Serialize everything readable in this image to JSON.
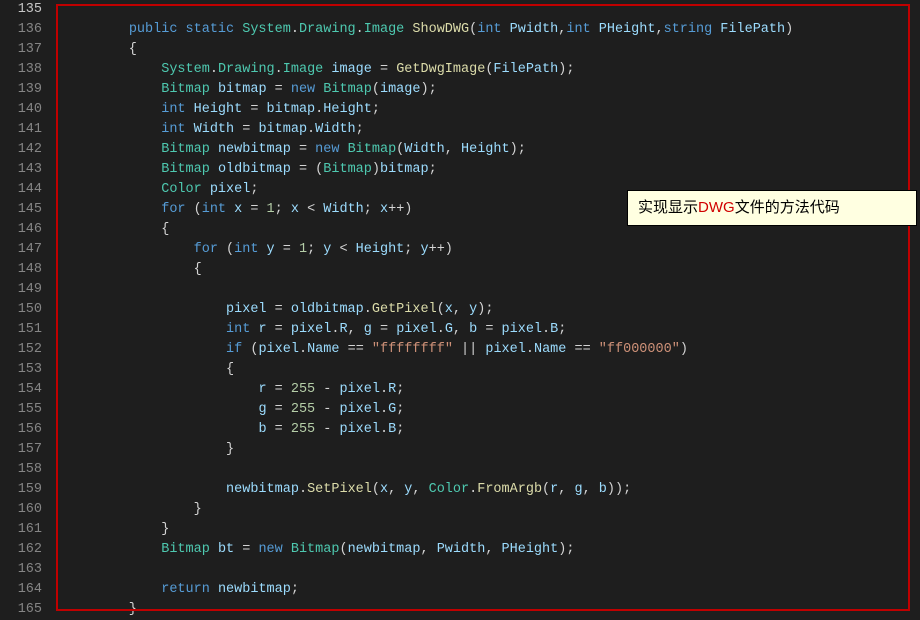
{
  "line_start": 135,
  "line_end": 165,
  "code_lines": [
    [],
    [
      [
        "        ",
        "plain"
      ],
      [
        "public static ",
        "keyword"
      ],
      [
        "System",
        "type"
      ],
      [
        ".",
        "punc"
      ],
      [
        "Drawing",
        "type"
      ],
      [
        ".",
        "punc"
      ],
      [
        "Image ",
        "type"
      ],
      [
        "ShowDWG",
        "method"
      ],
      [
        "(",
        "punc"
      ],
      [
        "int ",
        "keyword"
      ],
      [
        "Pwidth",
        "ident"
      ],
      [
        ",",
        "punc"
      ],
      [
        "int ",
        "keyword"
      ],
      [
        "PHeight",
        "ident"
      ],
      [
        ",",
        "punc"
      ],
      [
        "string ",
        "keyword"
      ],
      [
        "FilePath",
        "ident"
      ],
      [
        ")",
        "punc"
      ]
    ],
    [
      [
        "        {",
        "plain"
      ]
    ],
    [
      [
        "            ",
        "plain"
      ],
      [
        "System",
        "type"
      ],
      [
        ".",
        "punc"
      ],
      [
        "Drawing",
        "type"
      ],
      [
        ".",
        "punc"
      ],
      [
        "Image ",
        "type"
      ],
      [
        "image ",
        "ident"
      ],
      [
        "= ",
        "punc"
      ],
      [
        "GetDwgImage",
        "method"
      ],
      [
        "(",
        "punc"
      ],
      [
        "FilePath",
        "ident"
      ],
      [
        ");",
        "punc"
      ]
    ],
    [
      [
        "            ",
        "plain"
      ],
      [
        "Bitmap ",
        "type"
      ],
      [
        "bitmap ",
        "ident"
      ],
      [
        "= ",
        "punc"
      ],
      [
        "new ",
        "keyword"
      ],
      [
        "Bitmap",
        "type"
      ],
      [
        "(",
        "punc"
      ],
      [
        "image",
        "ident"
      ],
      [
        ");",
        "punc"
      ]
    ],
    [
      [
        "            ",
        "plain"
      ],
      [
        "int ",
        "keyword"
      ],
      [
        "Height ",
        "ident"
      ],
      [
        "= ",
        "punc"
      ],
      [
        "bitmap",
        "ident"
      ],
      [
        ".",
        "punc"
      ],
      [
        "Height",
        "ident"
      ],
      [
        ";",
        "punc"
      ]
    ],
    [
      [
        "            ",
        "plain"
      ],
      [
        "int ",
        "keyword"
      ],
      [
        "Width ",
        "ident"
      ],
      [
        "= ",
        "punc"
      ],
      [
        "bitmap",
        "ident"
      ],
      [
        ".",
        "punc"
      ],
      [
        "Width",
        "ident"
      ],
      [
        ";",
        "punc"
      ]
    ],
    [
      [
        "            ",
        "plain"
      ],
      [
        "Bitmap ",
        "type"
      ],
      [
        "newbitmap ",
        "ident"
      ],
      [
        "= ",
        "punc"
      ],
      [
        "new ",
        "keyword"
      ],
      [
        "Bitmap",
        "type"
      ],
      [
        "(",
        "punc"
      ],
      [
        "Width",
        "ident"
      ],
      [
        ", ",
        "punc"
      ],
      [
        "Height",
        "ident"
      ],
      [
        ");",
        "punc"
      ]
    ],
    [
      [
        "            ",
        "plain"
      ],
      [
        "Bitmap ",
        "type"
      ],
      [
        "oldbitmap ",
        "ident"
      ],
      [
        "= (",
        "punc"
      ],
      [
        "Bitmap",
        "type"
      ],
      [
        ")",
        "punc"
      ],
      [
        "bitmap",
        "ident"
      ],
      [
        ";",
        "punc"
      ]
    ],
    [
      [
        "            ",
        "plain"
      ],
      [
        "Color ",
        "type"
      ],
      [
        "pixel",
        "ident"
      ],
      [
        ";",
        "punc"
      ]
    ],
    [
      [
        "            ",
        "plain"
      ],
      [
        "for ",
        "keyword"
      ],
      [
        "(",
        "punc"
      ],
      [
        "int ",
        "keyword"
      ],
      [
        "x ",
        "ident"
      ],
      [
        "= ",
        "punc"
      ],
      [
        "1",
        "number"
      ],
      [
        "; ",
        "punc"
      ],
      [
        "x ",
        "ident"
      ],
      [
        "< ",
        "punc"
      ],
      [
        "Width",
        "ident"
      ],
      [
        "; ",
        "punc"
      ],
      [
        "x",
        "ident"
      ],
      [
        "++)",
        "punc"
      ]
    ],
    [
      [
        "            {",
        "plain"
      ]
    ],
    [
      [
        "                ",
        "plain"
      ],
      [
        "for ",
        "keyword"
      ],
      [
        "(",
        "punc"
      ],
      [
        "int ",
        "keyword"
      ],
      [
        "y ",
        "ident"
      ],
      [
        "= ",
        "punc"
      ],
      [
        "1",
        "number"
      ],
      [
        "; ",
        "punc"
      ],
      [
        "y ",
        "ident"
      ],
      [
        "< ",
        "punc"
      ],
      [
        "Height",
        "ident"
      ],
      [
        "; ",
        "punc"
      ],
      [
        "y",
        "ident"
      ],
      [
        "++)",
        "punc"
      ]
    ],
    [
      [
        "                {",
        "plain"
      ]
    ],
    [],
    [
      [
        "                    ",
        "plain"
      ],
      [
        "pixel ",
        "ident"
      ],
      [
        "= ",
        "punc"
      ],
      [
        "oldbitmap",
        "ident"
      ],
      [
        ".",
        "punc"
      ],
      [
        "GetPixel",
        "method"
      ],
      [
        "(",
        "punc"
      ],
      [
        "x",
        "ident"
      ],
      [
        ", ",
        "punc"
      ],
      [
        "y",
        "ident"
      ],
      [
        ");",
        "punc"
      ]
    ],
    [
      [
        "                    ",
        "plain"
      ],
      [
        "int ",
        "keyword"
      ],
      [
        "r ",
        "ident"
      ],
      [
        "= ",
        "punc"
      ],
      [
        "pixel",
        "ident"
      ],
      [
        ".",
        "punc"
      ],
      [
        "R",
        "ident"
      ],
      [
        ", ",
        "punc"
      ],
      [
        "g ",
        "ident"
      ],
      [
        "= ",
        "punc"
      ],
      [
        "pixel",
        "ident"
      ],
      [
        ".",
        "punc"
      ],
      [
        "G",
        "ident"
      ],
      [
        ", ",
        "punc"
      ],
      [
        "b ",
        "ident"
      ],
      [
        "= ",
        "punc"
      ],
      [
        "pixel",
        "ident"
      ],
      [
        ".",
        "punc"
      ],
      [
        "B",
        "ident"
      ],
      [
        ";",
        "punc"
      ]
    ],
    [
      [
        "                    ",
        "plain"
      ],
      [
        "if ",
        "keyword"
      ],
      [
        "(",
        "punc"
      ],
      [
        "pixel",
        "ident"
      ],
      [
        ".",
        "punc"
      ],
      [
        "Name ",
        "ident"
      ],
      [
        "== ",
        "punc"
      ],
      [
        "\"ffffffff\" ",
        "string"
      ],
      [
        "|| ",
        "punc"
      ],
      [
        "pixel",
        "ident"
      ],
      [
        ".",
        "punc"
      ],
      [
        "Name ",
        "ident"
      ],
      [
        "== ",
        "punc"
      ],
      [
        "\"ff000000\"",
        "string"
      ],
      [
        ")",
        "punc"
      ]
    ],
    [
      [
        "                    {",
        "plain"
      ]
    ],
    [
      [
        "                        ",
        "plain"
      ],
      [
        "r ",
        "ident"
      ],
      [
        "= ",
        "punc"
      ],
      [
        "255 ",
        "number"
      ],
      [
        "- ",
        "punc"
      ],
      [
        "pixel",
        "ident"
      ],
      [
        ".",
        "punc"
      ],
      [
        "R",
        "ident"
      ],
      [
        ";",
        "punc"
      ]
    ],
    [
      [
        "                        ",
        "plain"
      ],
      [
        "g ",
        "ident"
      ],
      [
        "= ",
        "punc"
      ],
      [
        "255 ",
        "number"
      ],
      [
        "- ",
        "punc"
      ],
      [
        "pixel",
        "ident"
      ],
      [
        ".",
        "punc"
      ],
      [
        "G",
        "ident"
      ],
      [
        ";",
        "punc"
      ]
    ],
    [
      [
        "                        ",
        "plain"
      ],
      [
        "b ",
        "ident"
      ],
      [
        "= ",
        "punc"
      ],
      [
        "255 ",
        "number"
      ],
      [
        "- ",
        "punc"
      ],
      [
        "pixel",
        "ident"
      ],
      [
        ".",
        "punc"
      ],
      [
        "B",
        "ident"
      ],
      [
        ";",
        "punc"
      ]
    ],
    [
      [
        "                    }",
        "plain"
      ]
    ],
    [],
    [
      [
        "                    ",
        "plain"
      ],
      [
        "newbitmap",
        "ident"
      ],
      [
        ".",
        "punc"
      ],
      [
        "SetPixel",
        "method"
      ],
      [
        "(",
        "punc"
      ],
      [
        "x",
        "ident"
      ],
      [
        ", ",
        "punc"
      ],
      [
        "y",
        "ident"
      ],
      [
        ", ",
        "punc"
      ],
      [
        "Color",
        "type"
      ],
      [
        ".",
        "punc"
      ],
      [
        "FromArgb",
        "method"
      ],
      [
        "(",
        "punc"
      ],
      [
        "r",
        "ident"
      ],
      [
        ", ",
        "punc"
      ],
      [
        "g",
        "ident"
      ],
      [
        ", ",
        "punc"
      ],
      [
        "b",
        "ident"
      ],
      [
        "));",
        "punc"
      ]
    ],
    [
      [
        "                }",
        "plain"
      ]
    ],
    [
      [
        "            }",
        "plain"
      ]
    ],
    [
      [
        "            ",
        "plain"
      ],
      [
        "Bitmap ",
        "type"
      ],
      [
        "bt ",
        "ident"
      ],
      [
        "= ",
        "punc"
      ],
      [
        "new ",
        "keyword"
      ],
      [
        "Bitmap",
        "type"
      ],
      [
        "(",
        "punc"
      ],
      [
        "newbitmap",
        "ident"
      ],
      [
        ", ",
        "punc"
      ],
      [
        "Pwidth",
        "ident"
      ],
      [
        ", ",
        "punc"
      ],
      [
        "PHeight",
        "ident"
      ],
      [
        ");",
        "punc"
      ]
    ],
    [],
    [
      [
        "            ",
        "plain"
      ],
      [
        "return ",
        "keyword"
      ],
      [
        "newbitmap",
        "ident"
      ],
      [
        ";",
        "punc"
      ]
    ],
    [
      [
        "        }",
        "plain"
      ]
    ]
  ],
  "annotation": {
    "prefix": "实现显示",
    "highlight": "DWG",
    "suffix": "文件的方法代码"
  }
}
